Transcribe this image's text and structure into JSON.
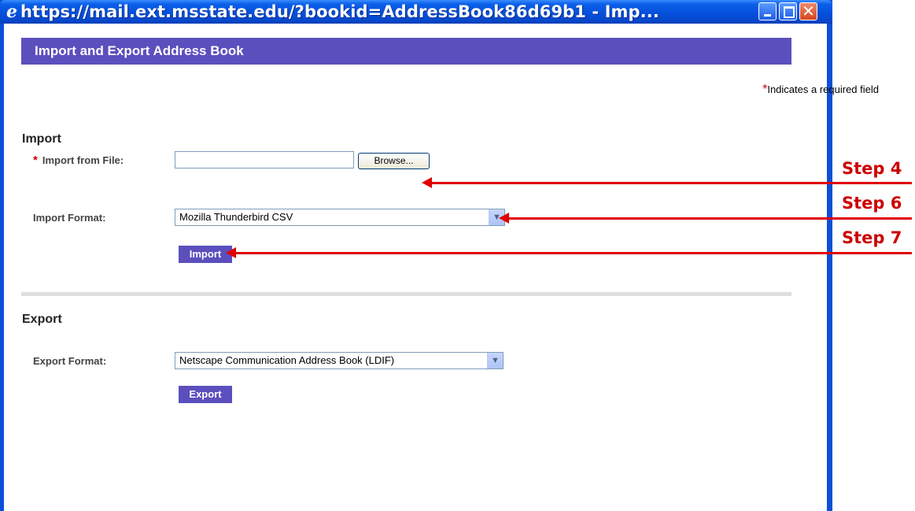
{
  "window": {
    "title": "https://mail.ext.msstate.edu/?bookid=AddressBook86d69b1 - Imp...",
    "icon": "ie-icon",
    "controls": [
      "minimize-icon",
      "maximize-icon",
      "close-icon"
    ]
  },
  "page": {
    "title": "Import and Export Address Book",
    "required_note_star": "*",
    "required_note": "Indicates a required field"
  },
  "import": {
    "section_title": "Import",
    "file_label_star": "*",
    "file_label": "Import from File:",
    "file_value": "",
    "browse_label": "Browse...",
    "format_label": "Import Format:",
    "format_value": "Mozilla Thunderbird CSV",
    "button_label": "Import"
  },
  "export": {
    "section_title": "Export",
    "format_label": "Export Format:",
    "format_value": "Netscape Communication Address Book (LDIF)",
    "button_label": "Export"
  },
  "annotations": [
    {
      "label": "Step 4"
    },
    {
      "label": "Step 6"
    },
    {
      "label": "Step 7"
    }
  ],
  "colors": {
    "accent": "#5b4fbe",
    "annotation": "#e00000",
    "title_bar": "#0550dc"
  }
}
